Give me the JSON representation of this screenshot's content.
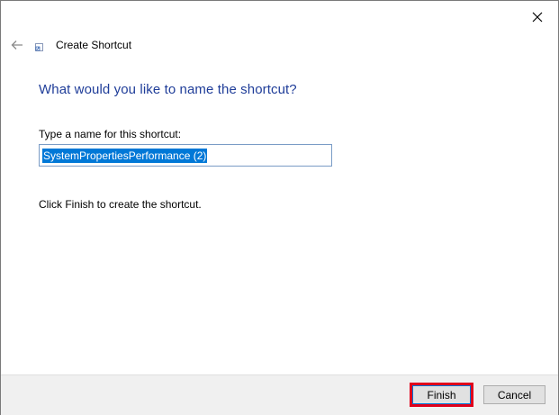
{
  "window": {
    "close_icon": "close-icon",
    "back_icon": "back-arrow-icon",
    "title_icon": "shortcut-icon",
    "title": "Create Shortcut"
  },
  "content": {
    "heading": "What would you like to name the shortcut?",
    "field_label": "Type a name for this shortcut:",
    "name_value": "SystemPropertiesPerformance (2)",
    "hint": "Click Finish to create the shortcut."
  },
  "footer": {
    "finish_label": "Finish",
    "cancel_label": "Cancel"
  },
  "colors": {
    "heading": "#1f3d99",
    "selection": "#0078d7",
    "highlight_box": "#e0001b",
    "footer_bg": "#f0f0f0"
  }
}
